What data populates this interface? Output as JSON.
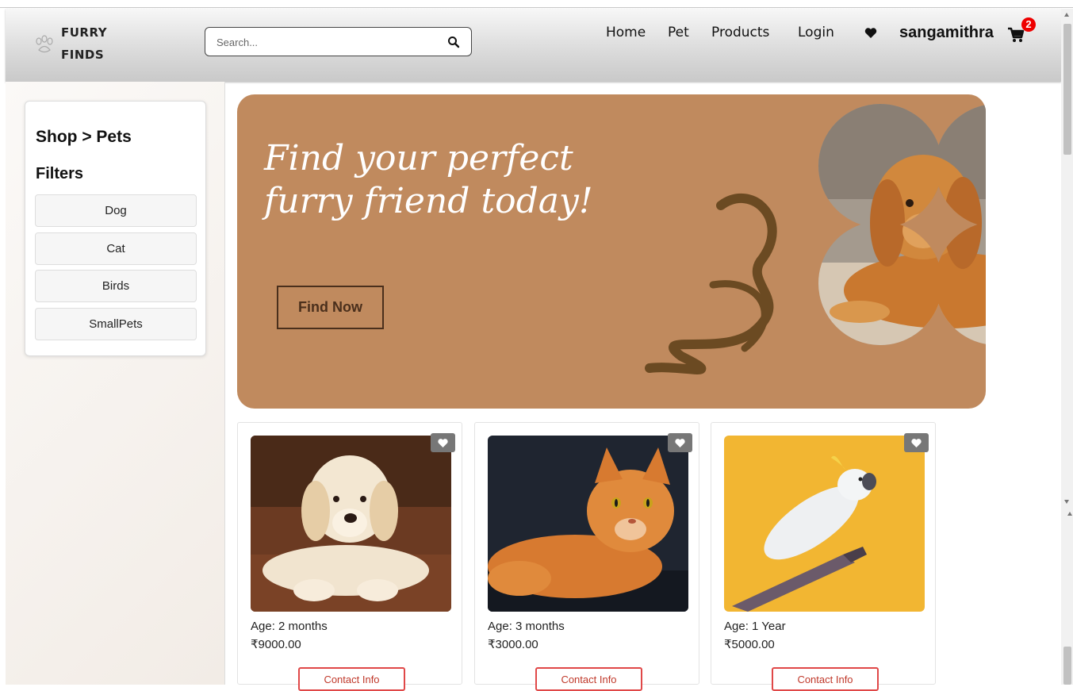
{
  "brand": {
    "line1": "FURRY",
    "line2": "FINDS"
  },
  "search": {
    "placeholder": "Search..."
  },
  "nav": {
    "home": "Home",
    "pet": "Pet",
    "products": "Products",
    "login": "Login",
    "username": "sangamithra",
    "cart_count": "2"
  },
  "sidebar": {
    "breadcrumb": "Shop > Pets",
    "filters_title": "Filters",
    "filters": [
      "Dog",
      "Cat",
      "Birds",
      "SmallPets"
    ]
  },
  "hero": {
    "headline": "Find your perfect furry friend today!",
    "button": "Find Now"
  },
  "pets": [
    {
      "age": "Age: 2 months",
      "price": "₹9000.00",
      "contact": "Contact Info",
      "kind": "golden-retriever-puppy"
    },
    {
      "age": "Age: 3 months",
      "price": "₹3000.00",
      "contact": "Contact Info",
      "kind": "orange-cat"
    },
    {
      "age": "Age: 1 Year",
      "price": "₹5000.00",
      "contact": "Contact Info",
      "kind": "cockatoo"
    }
  ],
  "colors": {
    "hero_bg": "#c08a5e",
    "accent_red": "#e04848",
    "badge": "#ee0000"
  }
}
